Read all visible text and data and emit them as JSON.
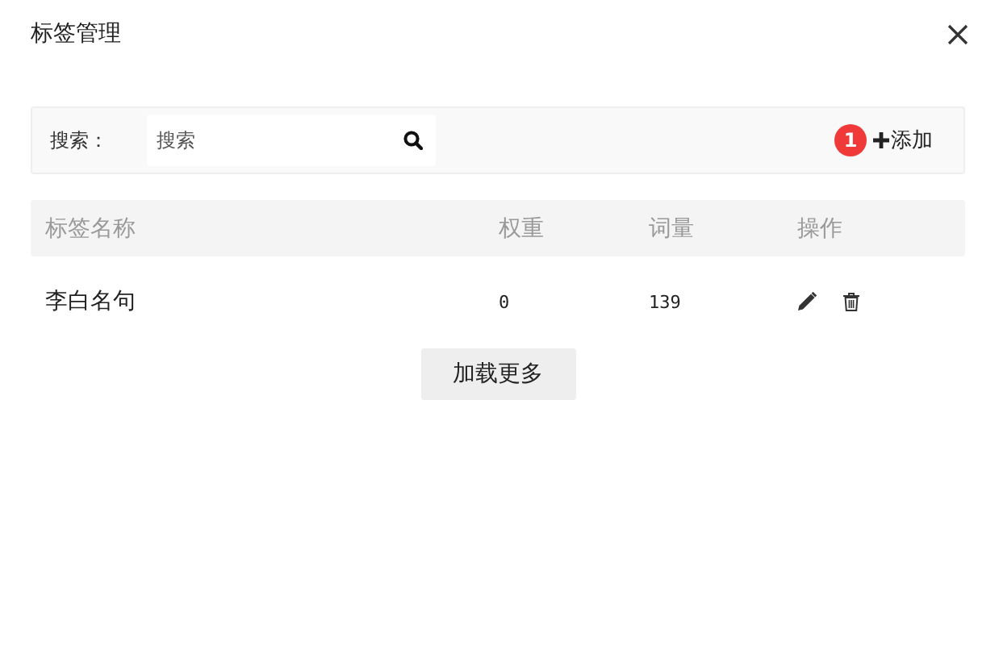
{
  "dialog": {
    "title": "标签管理"
  },
  "toolbar": {
    "search_label": "搜索：",
    "search": {
      "placeholder": "搜索"
    },
    "add_button": {
      "badge": "1",
      "label": "添加"
    }
  },
  "table": {
    "columns": [
      "标签名称",
      "权重",
      "词量",
      "操作"
    ],
    "rows": [
      {
        "name": "李白名句",
        "weight": "0",
        "count": "139"
      }
    ]
  },
  "load_more": "加载更多"
}
